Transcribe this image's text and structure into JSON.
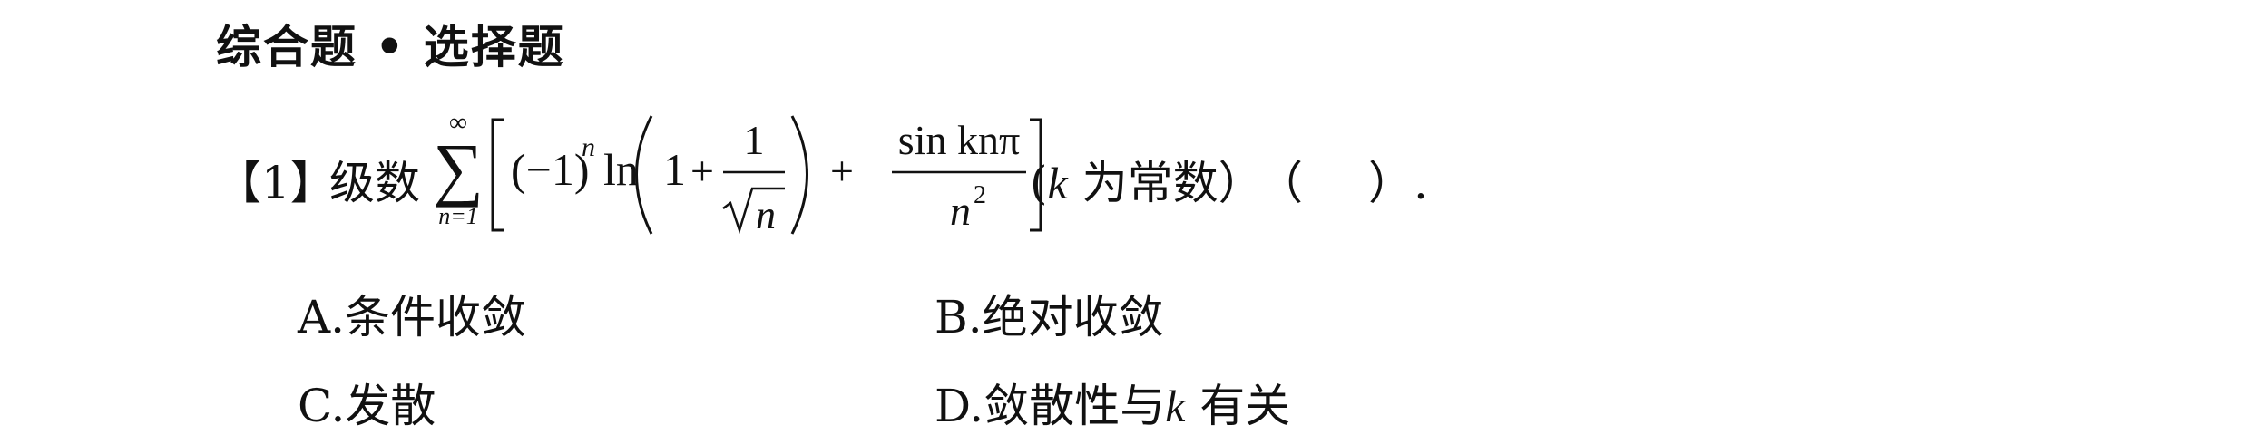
{
  "section": {
    "title": "综合题 • 选择题"
  },
  "question": {
    "number": "【1】",
    "stem": "级数",
    "formula": {
      "sum_upper": "∞",
      "sum_lower": "n=1",
      "term1_base": "(−1)",
      "term1_exp": "n",
      "ln": "ln",
      "one": "1",
      "plus": "+",
      "frac1_num": "1",
      "sqrt_arg": "n",
      "frac2_num": "sin knπ",
      "frac2_den_base": "n",
      "frac2_den_exp": "2"
    },
    "note_open": "(",
    "note_var": "k",
    "note_text": " 为常数）",
    "blank_open": "（",
    "blank_close": "）."
  },
  "options": {
    "a": {
      "letter": "A.",
      "text": "条件收敛"
    },
    "b": {
      "letter": "B.",
      "text": "绝对收敛"
    },
    "c": {
      "letter": "C.",
      "text": "发散"
    },
    "d": {
      "letter": "D.",
      "text_before": "敛散性与",
      "var": "k",
      "text_after": " 有关"
    }
  }
}
